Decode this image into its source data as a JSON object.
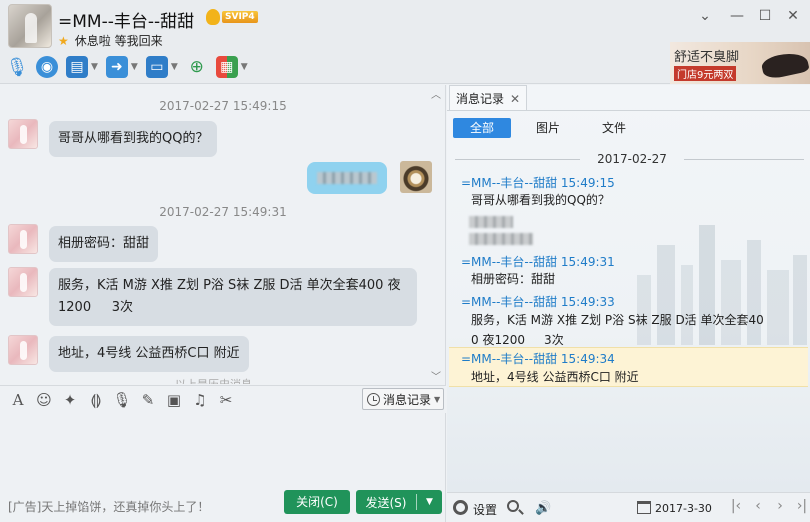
{
  "header": {
    "contact_name": "=MM--丰台--甜甜",
    "vip_badge": "SVIP4",
    "status_text": "休息啦 等我回来",
    "window_controls": [
      "chevron-down-icon",
      "minimize-icon",
      "maximize-icon",
      "close-icon"
    ],
    "toolbar_icons": [
      "voice-call-icon",
      "video-call-icon",
      "share-screen-icon",
      "send-file-icon",
      "remote-desktop-icon",
      "create-group-icon",
      "apps-icon"
    ]
  },
  "ad_banner": {
    "line1": "舒适不臭脚",
    "line2": "门店9元两双"
  },
  "chat": {
    "messages": [
      {
        "time": "2017-02-27 15:49:15"
      },
      {
        "from": "contact",
        "text": "哥哥从哪看到我的QQ的？"
      },
      {
        "from": "self",
        "text": ""
      },
      {
        "time": "2017-02-27 15:49:31"
      },
      {
        "from": "contact",
        "text": "相册密码：甜甜"
      },
      {
        "from": "contact",
        "text_line1": "服务，K活 M游 X推 Z划 P浴 S袜 Z服  D活 单次全套400 夜",
        "text_line2": "1200     3次"
      },
      {
        "from": "contact",
        "text": "地址，4号线  公益西桥C口  附近"
      }
    ],
    "more_hint": "以上是历史消息"
  },
  "input_toolbar": {
    "history_button": "消息记录"
  },
  "footer_left": {
    "ad_line": "[广告]天上掉馅饼，还真掉你头上了！",
    "close_button": "关闭(C)",
    "send_button": "发送(S)"
  },
  "right_panel": {
    "tab_label": "消息记录",
    "filter_tabs": [
      "全部",
      "图片",
      "文件"
    ],
    "date_separator": "2017-02-27",
    "records": [
      {
        "header": "=MM--丰台--甜甜 15:49:15",
        "body": "哥哥从哪看到我的QQ的？"
      },
      {
        "header": "=MM--丰台--甜甜 15:49:31",
        "body": "相册密码：甜甜"
      },
      {
        "header": "=MM--丰台--甜甜 15:49:33",
        "body_line1": "服务，K活 M游 X推 Z划 P浴 S袜 Z服  D活 单次全套40",
        "body_line2": "0 夜1200     3次"
      },
      {
        "header": "=MM--丰台--甜甜 15:49:34",
        "body": "地址，4号线  公益西桥C口  附近"
      }
    ]
  },
  "right_footer": {
    "settings_label": "设置",
    "date_value": "2017-3-30"
  }
}
